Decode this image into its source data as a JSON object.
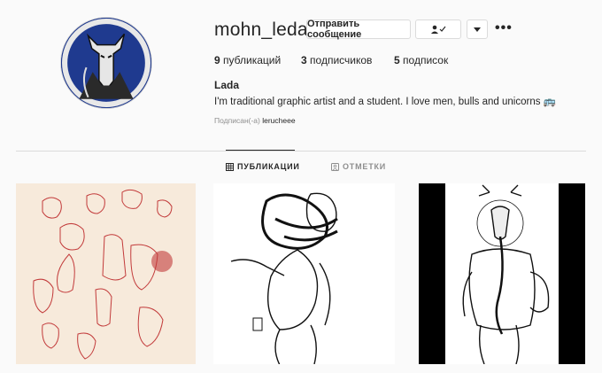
{
  "profile": {
    "username": "mohn_leda",
    "message_button": "Отправить сообщение",
    "follow_icon": "person-check-icon",
    "dropdown_icon": "chevron-down-icon",
    "more_icon": "ellipsis-icon",
    "more_label": "•••"
  },
  "stats": {
    "posts_count": "9",
    "posts_label": "публикаций",
    "followers_count": "3",
    "followers_label": "подписчиков",
    "following_count": "5",
    "following_label": "подписок"
  },
  "bio": {
    "name": "Lada",
    "text": "I'm traditional graphic artist and a student. I love men, bulls and unicorns 🚌",
    "followed_prefix": "Подписан(-а)",
    "followed_user": "lerucheee"
  },
  "tabs": [
    {
      "label": "ПУБЛИКАЦИИ",
      "icon": "grid-icon",
      "active": true
    },
    {
      "label": "ОТМЕТКИ",
      "icon": "tag-person-icon",
      "active": false
    }
  ],
  "posts": [
    {
      "icon": "red-sketch-bulls-artwork"
    },
    {
      "icon": "man-with-snake-artwork"
    },
    {
      "icon": "antlered-figure-artwork"
    }
  ]
}
